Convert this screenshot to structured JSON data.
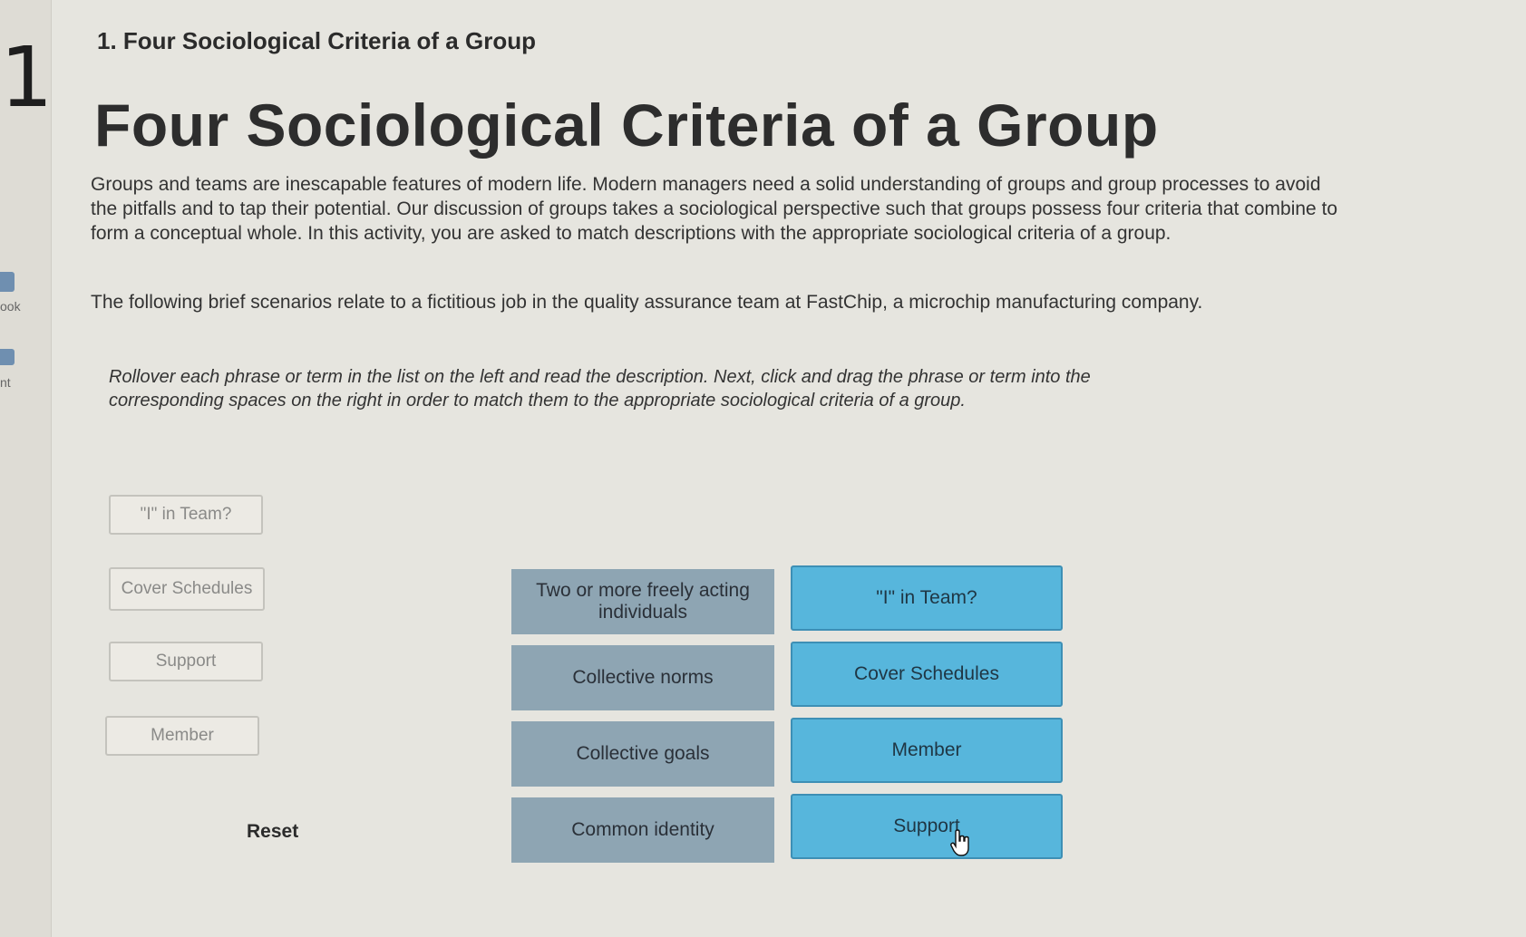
{
  "sidebar": {
    "number": "1",
    "items": [
      {
        "label": "ook"
      },
      {
        "label": "nt"
      }
    ]
  },
  "header": {
    "breadcrumb": "1. Four Sociological Criteria of a Group",
    "title": "Four Sociological Criteria of a Group"
  },
  "content": {
    "intro": "Groups and teams are inescapable features of modern life. Modern managers need a solid understanding of groups and group processes to avoid the pitfalls and to tap their potential. Our discussion of groups takes a sociological perspective such that groups possess four criteria that combine to form a conceptual whole. In this activity, you are asked to match descriptions with the appropriate sociological criteria of a group.",
    "scenario_note": "The following brief scenarios relate to a fictitious job in the quality assurance team at FastChip, a microchip manufacturing company.",
    "instructions": "Rollover each phrase or term in the list on the left and read the description. Next, click and drag the phrase or term into the corresponding spaces on the right in order to match them to the appropriate sociological criteria of a group."
  },
  "activity": {
    "source_items": [
      {
        "label": "\"I\" in Team?"
      },
      {
        "label": "Cover Schedules"
      },
      {
        "label": "Support"
      },
      {
        "label": "Member"
      }
    ],
    "reset_label": "Reset",
    "criteria": [
      {
        "label": "Two or more freely acting individuals",
        "answer": "\"I\" in Team?"
      },
      {
        "label": "Collective norms",
        "answer": "Cover Schedules"
      },
      {
        "label": "Collective goals",
        "answer": "Member"
      },
      {
        "label": "Common identity",
        "answer": "Support"
      }
    ]
  },
  "colors": {
    "criterion_bg": "#8ea5b3",
    "drop_zone_bg": "#57b6dc",
    "page_bg": "#e6e5df"
  }
}
